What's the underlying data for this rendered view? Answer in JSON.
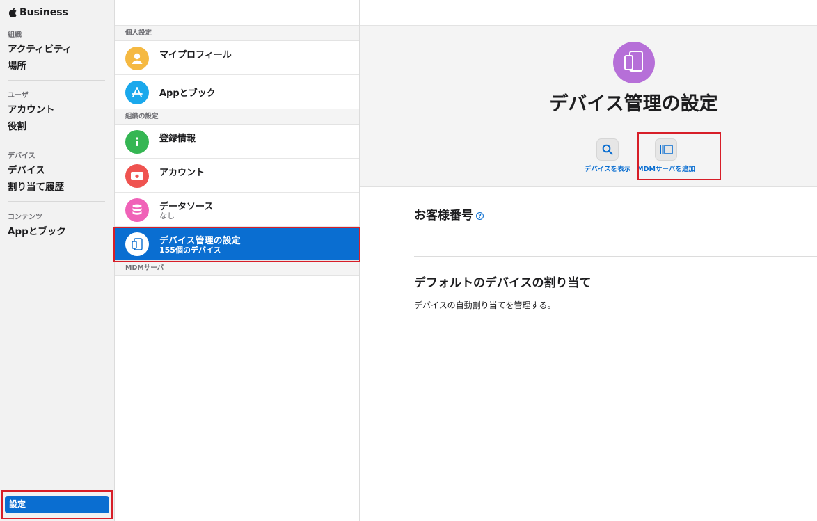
{
  "brand": {
    "name": "Business"
  },
  "nav": {
    "sections": [
      {
        "head": "組織",
        "items": [
          "アクティビティ",
          "場所"
        ]
      },
      {
        "head": "ユーザ",
        "items": [
          "アカウント",
          "役割"
        ]
      },
      {
        "head": "デバイス",
        "items": [
          "デバイス",
          "割り当て履歴"
        ]
      },
      {
        "head": "コンテンツ",
        "items": [
          "Appとブック"
        ]
      }
    ],
    "settings_label": "設定"
  },
  "list": {
    "groups": [
      {
        "label": "個人設定"
      },
      {
        "label": "組織の設定"
      },
      {
        "label": "MDMサーバ"
      }
    ],
    "rows": [
      {
        "title": "マイプロフィール",
        "icon": "person-icon",
        "color": "#f5b942"
      },
      {
        "title": "Appとブック",
        "icon": "app-store-icon",
        "color": "#1aa8ec"
      },
      {
        "title": "登録情報",
        "icon": "info-icon",
        "color": "#35b653"
      },
      {
        "title": "アカウント",
        "icon": "apple-account-icon",
        "color": "#ef5350"
      },
      {
        "title": "データソース",
        "subtitle": "なし",
        "icon": "database-icon",
        "color": "#f062b8"
      },
      {
        "title": "デバイス管理の設定",
        "subtitle": "155個のデバイス",
        "icon": "tablet-icon",
        "color": "#ffffff"
      }
    ]
  },
  "detail": {
    "title": "デバイス管理の設定",
    "icon_color": "#b66fd8",
    "actions": [
      {
        "label": "デバイスを表示",
        "icon": "search-icon"
      },
      {
        "label": "MDMサーバを追加",
        "icon": "server-icon"
      }
    ],
    "customer_number_title": "お客様番号",
    "help_glyph": "?",
    "default_assignment_title": "デフォルトのデバイスの割り当て",
    "default_assignment_desc": "デバイスの自動割り当てを管理する。"
  },
  "colors": {
    "accent": "#0a6ed1",
    "highlight": "#d71e28"
  }
}
